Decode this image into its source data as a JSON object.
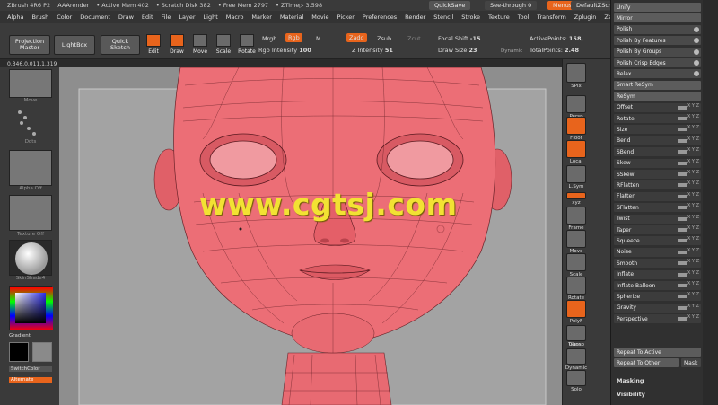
{
  "titlebar": {
    "app": "ZBrush 4R6 P2",
    "render": "AAArender",
    "active_mem": "• Active Mem 402",
    "scratch": "• Scratch Disk 382",
    "free_mem": "• Free Mem 2797",
    "ztime": "• ZTime▷ 3.598",
    "quicksave": "QuickSave",
    "seethrough": "See-through",
    "seethrough_val": "0",
    "menus": "Menus",
    "script": "DefaultZScript"
  },
  "menubar": [
    "Alpha",
    "Brush",
    "Color",
    "Document",
    "Draw",
    "Edit",
    "File",
    "Layer",
    "Light",
    "Macro",
    "Marker",
    "Material",
    "Movie",
    "Picker",
    "Preferences",
    "Render",
    "Stencil",
    "Stroke",
    "Texture",
    "Tool",
    "Transform",
    "Zplugin",
    "Zscript"
  ],
  "toolbar": {
    "projection_master": "Projection Master",
    "lightbox": "LightBox",
    "quick_sketch": "Quick Sketch",
    "edit": "Edit",
    "draw": "Draw",
    "move": "Move",
    "scale": "Scale",
    "rotate": "Rotate",
    "mrgb": "Mrgb",
    "rgb": "Rgb",
    "m": "M",
    "zadd": "Zadd",
    "zsub": "Zsub",
    "zcut": "Zcut",
    "rgb_intensity_label": "Rgb Intensity",
    "rgb_intensity": "100",
    "z_intensity_label": "Z Intensity",
    "z_intensity": "51",
    "focal_shift_label": "Focal Shift",
    "focal_shift": "-15",
    "draw_size_label": "Draw Size",
    "draw_size": "23",
    "dynamic": "Dynamic",
    "active_points_label": "ActivePoints:",
    "active_points": "158,",
    "total_points_label": "TotalPoints:",
    "total_points": "2.48"
  },
  "coords": "0.346,0.011,1.319",
  "leftpanel": {
    "move_caption": "Move",
    "dots_caption": "Dots",
    "alpha_caption": "Alpha Off",
    "texture_caption": "Texture Off",
    "material_caption": "SkinShade4",
    "gradient": "Gradient",
    "switchcolor": "SwitchColor",
    "alternate": "Alternate"
  },
  "watermark": "www.cgtsj.com",
  "rightstrip": [
    "SPix",
    "Persp",
    "Floor",
    "Local",
    "L.Sym",
    "xyz",
    "Frame",
    "Move",
    "Scale",
    "Rotate",
    "PolyF",
    "Transp",
    "Ghost",
    "Dynamic",
    "Solo"
  ],
  "rightpanel": {
    "items": [
      {
        "label": "Unify",
        "kind": "hdr"
      },
      {
        "label": "Mirror",
        "kind": "hdr"
      },
      {
        "label": "Polish",
        "kind": "dot"
      },
      {
        "label": "Polish By Features",
        "kind": "dot"
      },
      {
        "label": "Polish By Groups",
        "kind": "dot"
      },
      {
        "label": "Polish Crisp Edges",
        "kind": "dot"
      },
      {
        "label": "Relax",
        "kind": "dot"
      },
      {
        "label": "Smart ReSym",
        "kind": "hdr"
      },
      {
        "label": "ReSym",
        "kind": "hdr"
      },
      {
        "label": "Offset",
        "kind": "slider"
      },
      {
        "label": "Rotate",
        "kind": "slider"
      },
      {
        "label": "Size",
        "kind": "slider"
      },
      {
        "label": "Bend",
        "kind": "slider"
      },
      {
        "label": "SBend",
        "kind": "slider"
      },
      {
        "label": "Skew",
        "kind": "slider"
      },
      {
        "label": "SSkew",
        "kind": "slider"
      },
      {
        "label": "RFlatten",
        "kind": "slider"
      },
      {
        "label": "Flatten",
        "kind": "slider"
      },
      {
        "label": "SFlatten",
        "kind": "slider"
      },
      {
        "label": "Twist",
        "kind": "slider"
      },
      {
        "label": "Taper",
        "kind": "slider"
      },
      {
        "label": "Squeeze",
        "kind": "slider"
      },
      {
        "label": "Noise",
        "kind": "slider"
      },
      {
        "label": "Smooth",
        "kind": "slider"
      },
      {
        "label": "Inflate",
        "kind": "slider"
      },
      {
        "label": "Inflate Balloon",
        "kind": "slider"
      },
      {
        "label": "Spherize",
        "kind": "slider"
      },
      {
        "label": "Gravity",
        "kind": "slider"
      },
      {
        "label": "Perspective",
        "kind": "slider"
      }
    ],
    "repeat_to_active": "Repeat To Active",
    "repeat_to_other": "Repeat To Other",
    "mask": "Mask",
    "masking": "Masking",
    "visibility": "Visibility",
    "xyz": "X Y Z"
  },
  "colors": {
    "accent": "#e8641c",
    "head": "#e86a72",
    "watermark": "#f2e233"
  }
}
